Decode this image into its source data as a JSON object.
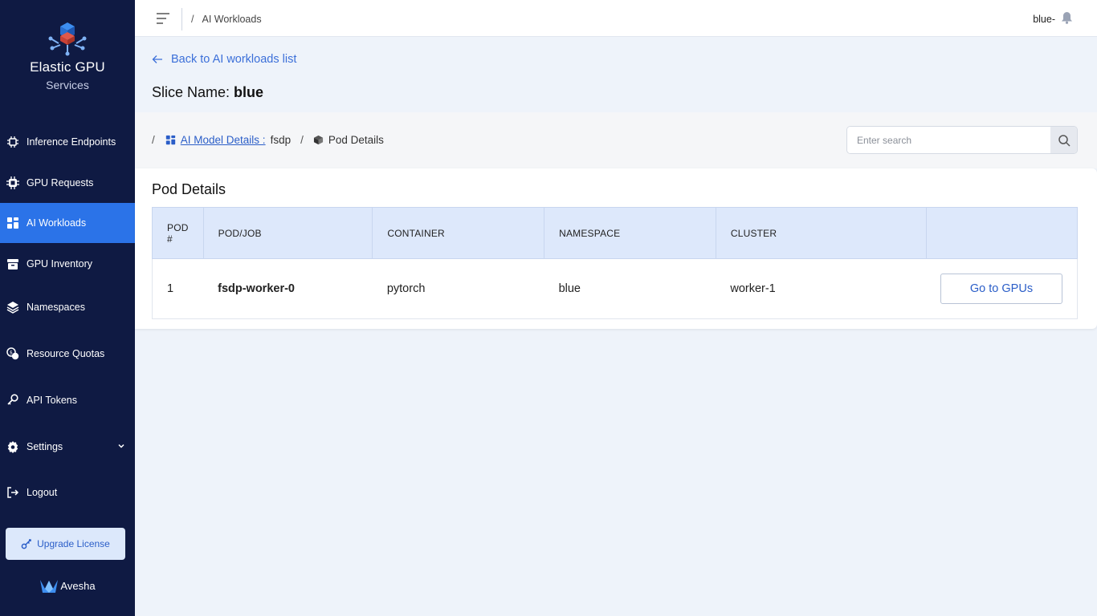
{
  "sidebar": {
    "brand_title": "Elastic GPU",
    "brand_subtitle": "Services",
    "items": [
      {
        "label": "Inference Endpoints",
        "icon": "chip-icon"
      },
      {
        "label": "GPU Requests",
        "icon": "gpu-chip-icon"
      },
      {
        "label": "AI Workloads",
        "icon": "dashboard-icon",
        "active": true
      },
      {
        "label": "GPU Inventory",
        "icon": "inventory-icon"
      },
      {
        "label": "Namespaces",
        "icon": "layers-icon"
      },
      {
        "label": "Resource Quotas",
        "icon": "coins-icon"
      },
      {
        "label": "API Tokens",
        "icon": "key-icon"
      },
      {
        "label": "Settings",
        "icon": "gear-icon"
      },
      {
        "label": "Logout",
        "icon": "logout-icon"
      }
    ],
    "upgrade_label": "Upgrade License",
    "footer_logo": "Avesha"
  },
  "header": {
    "breadcrumb": "AI Workloads",
    "user": "blue-"
  },
  "main": {
    "back_link": "Back to AI workloads list",
    "slice_label": "Slice Name:",
    "slice_name": "blue",
    "breadcrumb": {
      "model_link": "AI Model Details :",
      "model_value": "fsdp",
      "current": "Pod Details"
    },
    "search": {
      "placeholder": "Enter search"
    },
    "card_title": "Pod Details",
    "table": {
      "columns": [
        "POD #",
        "POD/JOB",
        "CONTAINER",
        "NAMESPACE",
        "CLUSTER",
        ""
      ],
      "rows": [
        {
          "pod": "1",
          "job": "fsdp-worker-0",
          "container": "pytorch",
          "namespace": "blue",
          "cluster": "worker-1",
          "action": "Go to GPUs"
        }
      ]
    }
  },
  "colors": {
    "sidebar_bg": "#0f1a43",
    "active": "#2b73e8",
    "link": "#3b6fd9",
    "table_header": "#dde8fb"
  }
}
